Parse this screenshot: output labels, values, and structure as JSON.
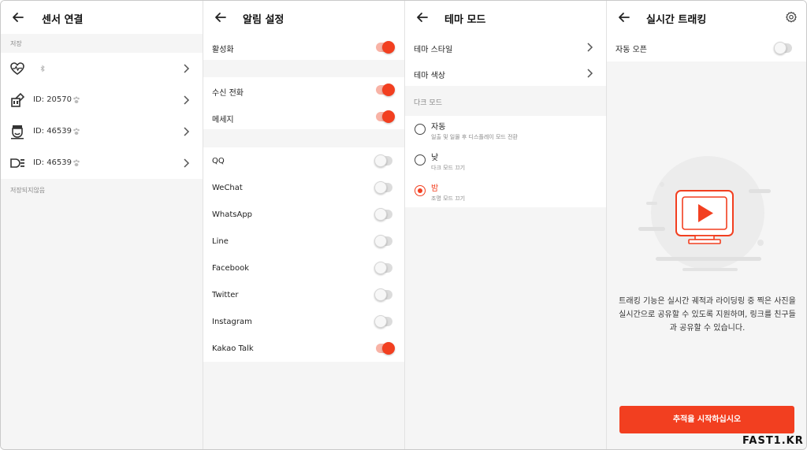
{
  "panel1": {
    "title": "센서 연결",
    "saved_label": "저장",
    "unsaved_label": "저장되지않음",
    "sensors": [
      {
        "icon": "heart-rate-icon",
        "id_text": "",
        "signal_icon": "bluetooth-icon"
      },
      {
        "icon": "power-meter-icon",
        "id_text": "ID: 20570",
        "signal_icon": "ant-plus-icon"
      },
      {
        "icon": "cadence-sensor-icon",
        "id_text": "ID: 46539",
        "signal_icon": "ant-plus-icon"
      },
      {
        "icon": "speed-sensor-icon",
        "id_text": "ID: 46539",
        "signal_icon": "ant-plus-icon"
      }
    ]
  },
  "panel2": {
    "title": "알림 설정",
    "items": [
      {
        "label": "활성화",
        "on": true
      },
      {
        "label": "수신 전화",
        "on": true
      },
      {
        "label": "메세지",
        "on": true
      },
      {
        "label": "QQ",
        "on": false
      },
      {
        "label": "WeChat",
        "on": false
      },
      {
        "label": "WhatsApp",
        "on": false
      },
      {
        "label": "Line",
        "on": false
      },
      {
        "label": "Facebook",
        "on": false
      },
      {
        "label": "Twitter",
        "on": false
      },
      {
        "label": "Instagram",
        "on": false
      },
      {
        "label": "Kakao Talk",
        "on": true
      }
    ]
  },
  "panel3": {
    "title": "테마 모드",
    "theme_style": "테마 스타일",
    "theme_color": "테마 색상",
    "dark_mode_label": "다크 모드",
    "options": [
      {
        "title": "자동",
        "subtitle": "일출 및 일몰 후 디스플레이 모드 전환",
        "selected": false
      },
      {
        "title": "낮",
        "subtitle": "다크 모드 끄기",
        "selected": false
      },
      {
        "title": "밤",
        "subtitle": "조명 모드 끄기",
        "selected": true
      }
    ]
  },
  "panel4": {
    "title": "실시간 트래킹",
    "auto_open_label": "자동 오픈",
    "auto_open_on": false,
    "description": "트래킹 기능은 실시간 궤적과 라이딩링 중 찍은 사진을실시간으로 공유할 수 있도록 지원하며, 링크를 친구들과 공유할 수 있습니다.",
    "start_button": "추적을 시작하십시오"
  },
  "watermark": "FAST1.KR",
  "colors": {
    "accent": "#f23f20",
    "background": "#f5f5f5"
  }
}
